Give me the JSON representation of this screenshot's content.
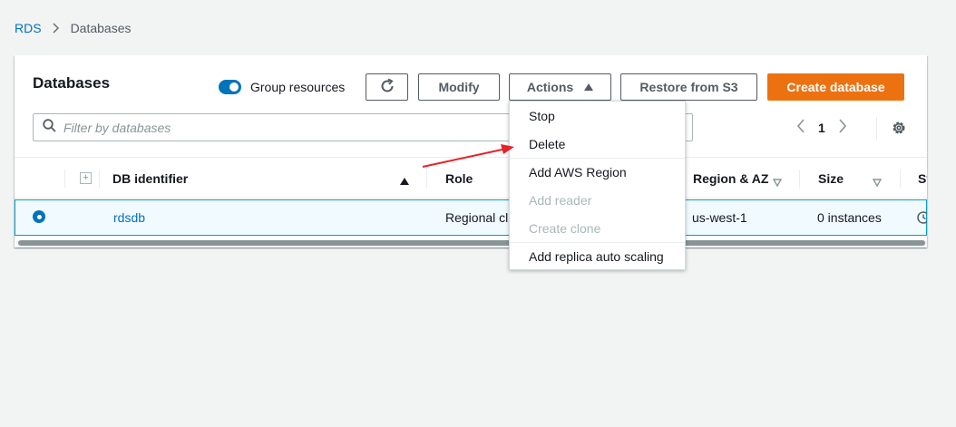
{
  "breadcrumb": {
    "root": "RDS",
    "current": "Databases"
  },
  "panel": {
    "title": "Databases",
    "group_resources_label": "Group resources",
    "group_resources_on": true
  },
  "toolbar": {
    "modify_label": "Modify",
    "actions_label": "Actions",
    "restore_label": "Restore from S3",
    "create_label": "Create database"
  },
  "filter": {
    "placeholder": "Filter by databases"
  },
  "pagination": {
    "current_page": "1"
  },
  "table": {
    "columns": [
      "DB identifier",
      "Role",
      "Region & AZ",
      "Size",
      "St"
    ],
    "rows": [
      {
        "identifier": "rdsdb",
        "role": "Regional clu",
        "region": "us-west-1",
        "size": "0 instances"
      }
    ]
  },
  "actions_menu": {
    "items": [
      {
        "label": "Stop",
        "disabled": false
      },
      {
        "label": "Delete",
        "disabled": false
      },
      {
        "label": "Add AWS Region",
        "disabled": false
      },
      {
        "label": "Add reader",
        "disabled": true
      },
      {
        "label": "Create clone",
        "disabled": true
      },
      {
        "label": "Add replica auto scaling",
        "disabled": false
      }
    ]
  },
  "colors": {
    "link": "#0073bb",
    "primary_button": "#ec7211",
    "selected_row_border": "#00a1c9",
    "annotation_arrow": "#e8202a"
  }
}
